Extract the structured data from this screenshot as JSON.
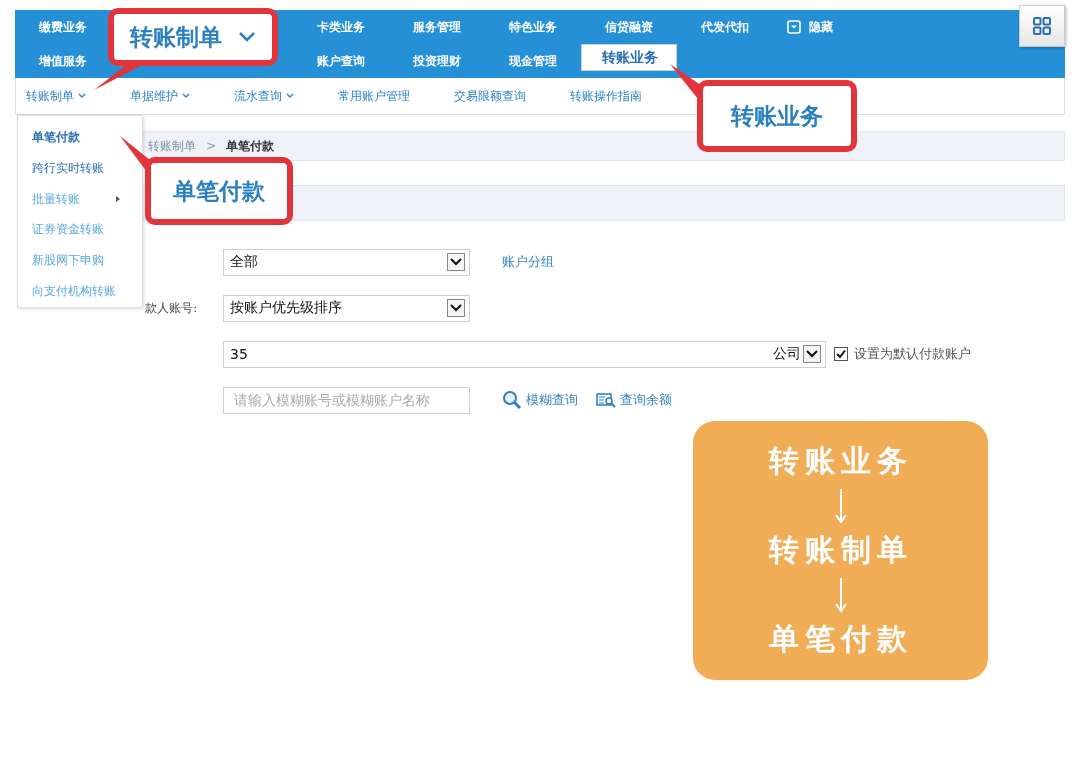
{
  "top_nav": {
    "rows": [
      [
        {
          "label": "缴费业务",
          "selected": false
        },
        {
          "label": "卡类业务",
          "selected": false
        },
        {
          "label": "服务管理",
          "selected": false
        },
        {
          "label": "特色业务",
          "selected": false
        },
        {
          "label": "信贷融资",
          "selected": false
        },
        {
          "label": "代发代扣",
          "selected": false
        }
      ],
      [
        {
          "label": "增值服务",
          "selected": false
        },
        {
          "label": "账户查询",
          "selected": false
        },
        {
          "label": "投资理财",
          "selected": false
        },
        {
          "label": "现金管理",
          "selected": false
        },
        {
          "label": "转账业务",
          "selected": true
        }
      ]
    ],
    "hide_toggle": {
      "label": "隐藏"
    }
  },
  "sub_nav": [
    {
      "label": "转账制单",
      "has_menu": true
    },
    {
      "label": "单据维护",
      "has_menu": true
    },
    {
      "label": "流水查询",
      "has_menu": true
    },
    {
      "label": "常用账户管理",
      "has_menu": false
    },
    {
      "label": "交易限额查询",
      "has_menu": false
    },
    {
      "label": "转账操作指南",
      "has_menu": false
    }
  ],
  "dropdown_menu": [
    {
      "label": "单笔付款",
      "selected": true,
      "has_submenu": false
    },
    {
      "label": "跨行实时转账",
      "selected": false,
      "has_submenu": false
    },
    {
      "label": "批量转账",
      "selected": false,
      "has_submenu": true
    },
    {
      "label": "证券资金转账",
      "selected": false,
      "has_submenu": false
    },
    {
      "label": "新股网下申购",
      "selected": false,
      "has_submenu": false
    },
    {
      "label": "向支付机构转账",
      "selected": false,
      "has_submenu": false
    }
  ],
  "breadcrumb": {
    "items": [
      "转账制单",
      "单笔付款"
    ],
    "separator": ">"
  },
  "form": {
    "group_select": {
      "value": "全部",
      "link": "账户分组"
    },
    "account_label": "款人账号:",
    "sort_select": {
      "value": "按账户优先级排序"
    },
    "account_select": {
      "value": "35",
      "tail": "公司",
      "default_checkbox": {
        "label": "设置为默认付款账户",
        "checked": true
      }
    },
    "search": {
      "placeholder": "请输入模糊账号或模糊账户名称",
      "fuzzy_link": "模糊查询",
      "balance_link": "查询余额"
    }
  },
  "callouts": [
    {
      "text": "转账制单",
      "caret": true
    },
    {
      "text": "转账业务",
      "caret": false
    },
    {
      "text": "单笔付款",
      "caret": false
    }
  ],
  "flow_card": {
    "steps": [
      "转账业务",
      "转账制单",
      "单笔付款"
    ]
  }
}
